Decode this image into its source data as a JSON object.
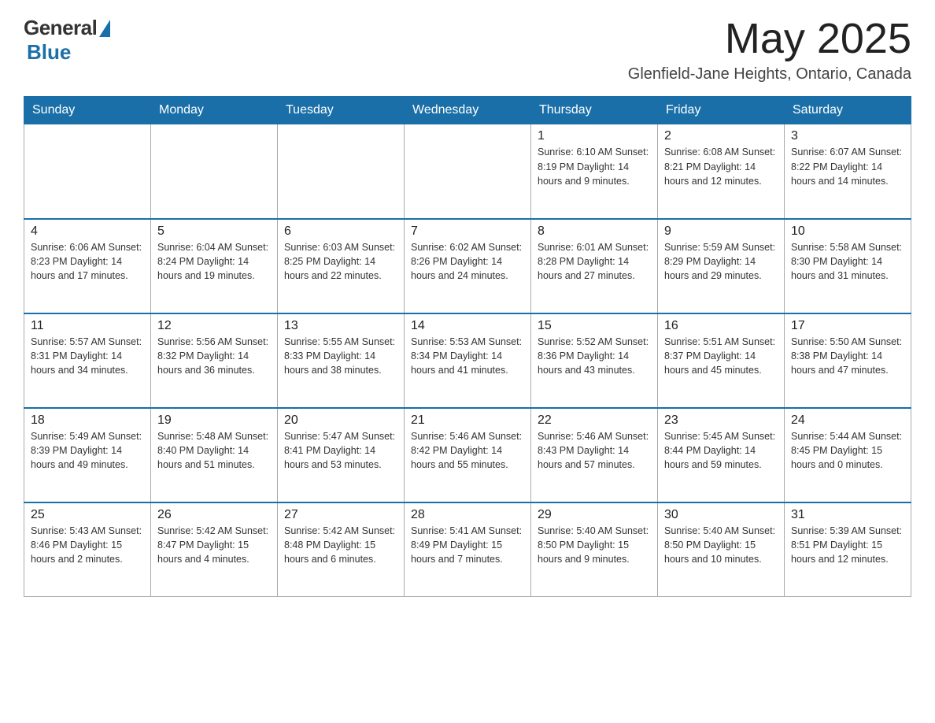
{
  "header": {
    "logo_general": "General",
    "logo_blue": "Blue",
    "month": "May 2025",
    "location": "Glenfield-Jane Heights, Ontario, Canada"
  },
  "days_of_week": [
    "Sunday",
    "Monday",
    "Tuesday",
    "Wednesday",
    "Thursday",
    "Friday",
    "Saturday"
  ],
  "weeks": [
    [
      {
        "day": "",
        "info": ""
      },
      {
        "day": "",
        "info": ""
      },
      {
        "day": "",
        "info": ""
      },
      {
        "day": "",
        "info": ""
      },
      {
        "day": "1",
        "info": "Sunrise: 6:10 AM\nSunset: 8:19 PM\nDaylight: 14 hours\nand 9 minutes."
      },
      {
        "day": "2",
        "info": "Sunrise: 6:08 AM\nSunset: 8:21 PM\nDaylight: 14 hours\nand 12 minutes."
      },
      {
        "day": "3",
        "info": "Sunrise: 6:07 AM\nSunset: 8:22 PM\nDaylight: 14 hours\nand 14 minutes."
      }
    ],
    [
      {
        "day": "4",
        "info": "Sunrise: 6:06 AM\nSunset: 8:23 PM\nDaylight: 14 hours\nand 17 minutes."
      },
      {
        "day": "5",
        "info": "Sunrise: 6:04 AM\nSunset: 8:24 PM\nDaylight: 14 hours\nand 19 minutes."
      },
      {
        "day": "6",
        "info": "Sunrise: 6:03 AM\nSunset: 8:25 PM\nDaylight: 14 hours\nand 22 minutes."
      },
      {
        "day": "7",
        "info": "Sunrise: 6:02 AM\nSunset: 8:26 PM\nDaylight: 14 hours\nand 24 minutes."
      },
      {
        "day": "8",
        "info": "Sunrise: 6:01 AM\nSunset: 8:28 PM\nDaylight: 14 hours\nand 27 minutes."
      },
      {
        "day": "9",
        "info": "Sunrise: 5:59 AM\nSunset: 8:29 PM\nDaylight: 14 hours\nand 29 minutes."
      },
      {
        "day": "10",
        "info": "Sunrise: 5:58 AM\nSunset: 8:30 PM\nDaylight: 14 hours\nand 31 minutes."
      }
    ],
    [
      {
        "day": "11",
        "info": "Sunrise: 5:57 AM\nSunset: 8:31 PM\nDaylight: 14 hours\nand 34 minutes."
      },
      {
        "day": "12",
        "info": "Sunrise: 5:56 AM\nSunset: 8:32 PM\nDaylight: 14 hours\nand 36 minutes."
      },
      {
        "day": "13",
        "info": "Sunrise: 5:55 AM\nSunset: 8:33 PM\nDaylight: 14 hours\nand 38 minutes."
      },
      {
        "day": "14",
        "info": "Sunrise: 5:53 AM\nSunset: 8:34 PM\nDaylight: 14 hours\nand 41 minutes."
      },
      {
        "day": "15",
        "info": "Sunrise: 5:52 AM\nSunset: 8:36 PM\nDaylight: 14 hours\nand 43 minutes."
      },
      {
        "day": "16",
        "info": "Sunrise: 5:51 AM\nSunset: 8:37 PM\nDaylight: 14 hours\nand 45 minutes."
      },
      {
        "day": "17",
        "info": "Sunrise: 5:50 AM\nSunset: 8:38 PM\nDaylight: 14 hours\nand 47 minutes."
      }
    ],
    [
      {
        "day": "18",
        "info": "Sunrise: 5:49 AM\nSunset: 8:39 PM\nDaylight: 14 hours\nand 49 minutes."
      },
      {
        "day": "19",
        "info": "Sunrise: 5:48 AM\nSunset: 8:40 PM\nDaylight: 14 hours\nand 51 minutes."
      },
      {
        "day": "20",
        "info": "Sunrise: 5:47 AM\nSunset: 8:41 PM\nDaylight: 14 hours\nand 53 minutes."
      },
      {
        "day": "21",
        "info": "Sunrise: 5:46 AM\nSunset: 8:42 PM\nDaylight: 14 hours\nand 55 minutes."
      },
      {
        "day": "22",
        "info": "Sunrise: 5:46 AM\nSunset: 8:43 PM\nDaylight: 14 hours\nand 57 minutes."
      },
      {
        "day": "23",
        "info": "Sunrise: 5:45 AM\nSunset: 8:44 PM\nDaylight: 14 hours\nand 59 minutes."
      },
      {
        "day": "24",
        "info": "Sunrise: 5:44 AM\nSunset: 8:45 PM\nDaylight: 15 hours\nand 0 minutes."
      }
    ],
    [
      {
        "day": "25",
        "info": "Sunrise: 5:43 AM\nSunset: 8:46 PM\nDaylight: 15 hours\nand 2 minutes."
      },
      {
        "day": "26",
        "info": "Sunrise: 5:42 AM\nSunset: 8:47 PM\nDaylight: 15 hours\nand 4 minutes."
      },
      {
        "day": "27",
        "info": "Sunrise: 5:42 AM\nSunset: 8:48 PM\nDaylight: 15 hours\nand 6 minutes."
      },
      {
        "day": "28",
        "info": "Sunrise: 5:41 AM\nSunset: 8:49 PM\nDaylight: 15 hours\nand 7 minutes."
      },
      {
        "day": "29",
        "info": "Sunrise: 5:40 AM\nSunset: 8:50 PM\nDaylight: 15 hours\nand 9 minutes."
      },
      {
        "day": "30",
        "info": "Sunrise: 5:40 AM\nSunset: 8:50 PM\nDaylight: 15 hours\nand 10 minutes."
      },
      {
        "day": "31",
        "info": "Sunrise: 5:39 AM\nSunset: 8:51 PM\nDaylight: 15 hours\nand 12 minutes."
      }
    ]
  ]
}
